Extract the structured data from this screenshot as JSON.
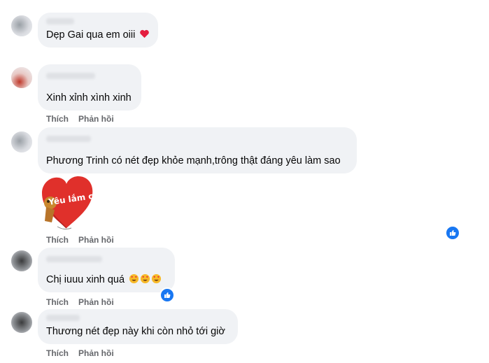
{
  "comments": [
    {
      "text": "Dẹp Gai qua em oiii",
      "emoji": "red-heart"
    },
    {
      "text": "Xinh xỉnh xình xinh",
      "actions": [
        "Thích",
        "Phản hồi"
      ]
    },
    {
      "text": "Phương Trinh có nét đẹp khỏe mạnh,trông thật đáng yêu làm sao",
      "actions": [
        "Thích",
        "Phản hồi"
      ],
      "sticker_text": "Yêu lắm cơ"
    },
    {
      "text": "Chị iuuu xinh quá",
      "emoji": "heart-eyes",
      "actions": [
        "Thích",
        "Phản hồi"
      ]
    },
    {
      "text": "Thương nét đẹp này khi còn nhỏ tới giờ",
      "actions": [
        "Thích",
        "Phản hồi"
      ]
    }
  ],
  "colors": {
    "bubble": "#f0f2f5",
    "action_text": "#65676b",
    "like_blue": "#1877f2"
  }
}
